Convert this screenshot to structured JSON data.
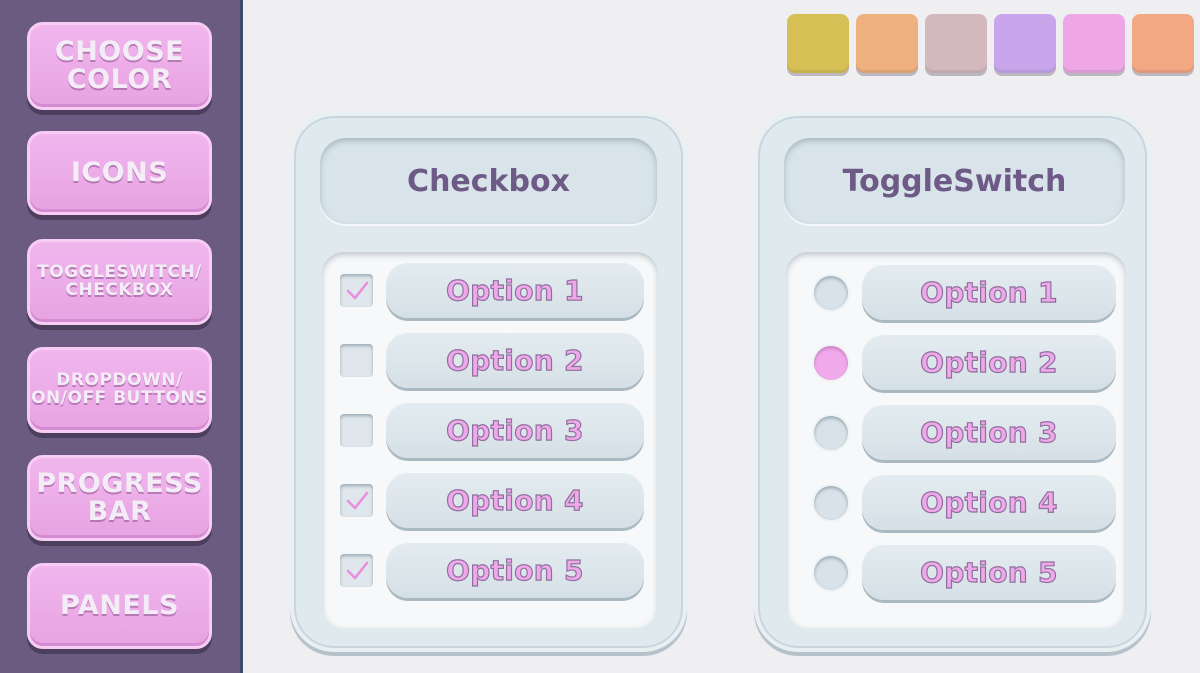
{
  "sidebar": {
    "buttons": [
      {
        "label": "CHOOSE\nCOLOR"
      },
      {
        "label": "ICONS"
      },
      {
        "label": "TOGGLESWITCH/\nCHECKBOX"
      },
      {
        "label": "DROPDOWN/\nON/OFF BUTTONS"
      },
      {
        "label": "PROGRESS\nBAR"
      },
      {
        "label": "PANELS"
      }
    ]
  },
  "swatches": [
    "#d6c055",
    "#eeb07e",
    "#d3b9bd",
    "#c9a6ec",
    "#eea6e6",
    "#f3a884"
  ],
  "colors": {
    "sidebar_bg": "#6c5b80",
    "button_pink": "#eaa9e5",
    "panel_bg": "#dfe9ee",
    "title_text": "#6e5a86",
    "option_text": "#efa8e9"
  },
  "checkbox_panel": {
    "title": "Checkbox",
    "options": [
      {
        "label": "Option 1",
        "checked": true
      },
      {
        "label": "Option 2",
        "checked": false
      },
      {
        "label": "Option 3",
        "checked": false
      },
      {
        "label": "Option 4",
        "checked": true
      },
      {
        "label": "Option 5",
        "checked": true
      }
    ]
  },
  "toggle_panel": {
    "title": "ToggleSwitch",
    "options": [
      {
        "label": "Option 1",
        "selected": false
      },
      {
        "label": "Option 2",
        "selected": true
      },
      {
        "label": "Option 3",
        "selected": false
      },
      {
        "label": "Option 4",
        "selected": false
      },
      {
        "label": "Option 5",
        "selected": false
      }
    ]
  }
}
